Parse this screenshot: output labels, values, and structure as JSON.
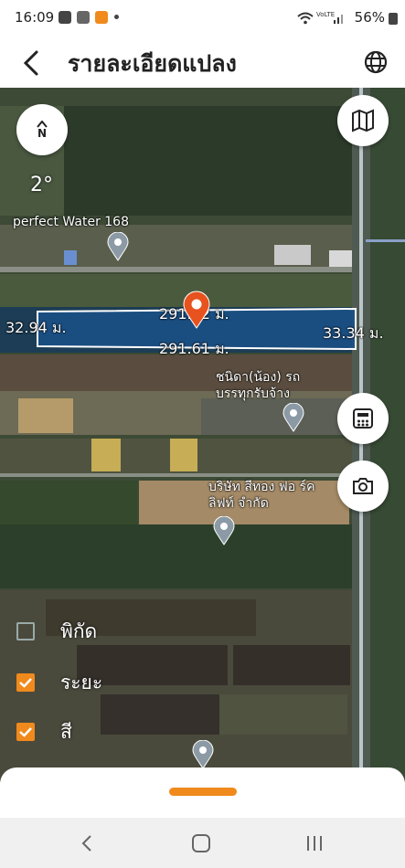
{
  "status_bar": {
    "time": "16:09",
    "battery": "56%",
    "network": "VoLTE"
  },
  "header": {
    "title": "รายละเอียดแปลง",
    "back_icon": "chevron-left-icon",
    "language_icon": "globe-icon"
  },
  "map": {
    "rotation": "2°",
    "compass_label": "N",
    "places": [
      {
        "name": "perfect Water 168"
      },
      {
        "name": "ชนิดา(น้อง) รถ บรรทุกรับจ้าง"
      },
      {
        "name": "บริษัท สีทอง ฟอ ร์คลิฟท์ จำกัด"
      }
    ],
    "distances": {
      "top": "291.62 ม.",
      "bottom": "291.61 ม.",
      "left": "32.94 ม.",
      "right": "33.34 ม."
    },
    "layers": [
      {
        "label": "พิกัด",
        "checked": false
      },
      {
        "label": "ระยะ",
        "checked": true
      },
      {
        "label": "สี",
        "checked": true
      }
    ],
    "buttons": [
      "map-icon",
      "calculator-icon",
      "camera-icon"
    ]
  },
  "colors": {
    "accent": "#f08a1c",
    "plot_fill": "#1a4f86",
    "pin": "#e8521e"
  }
}
